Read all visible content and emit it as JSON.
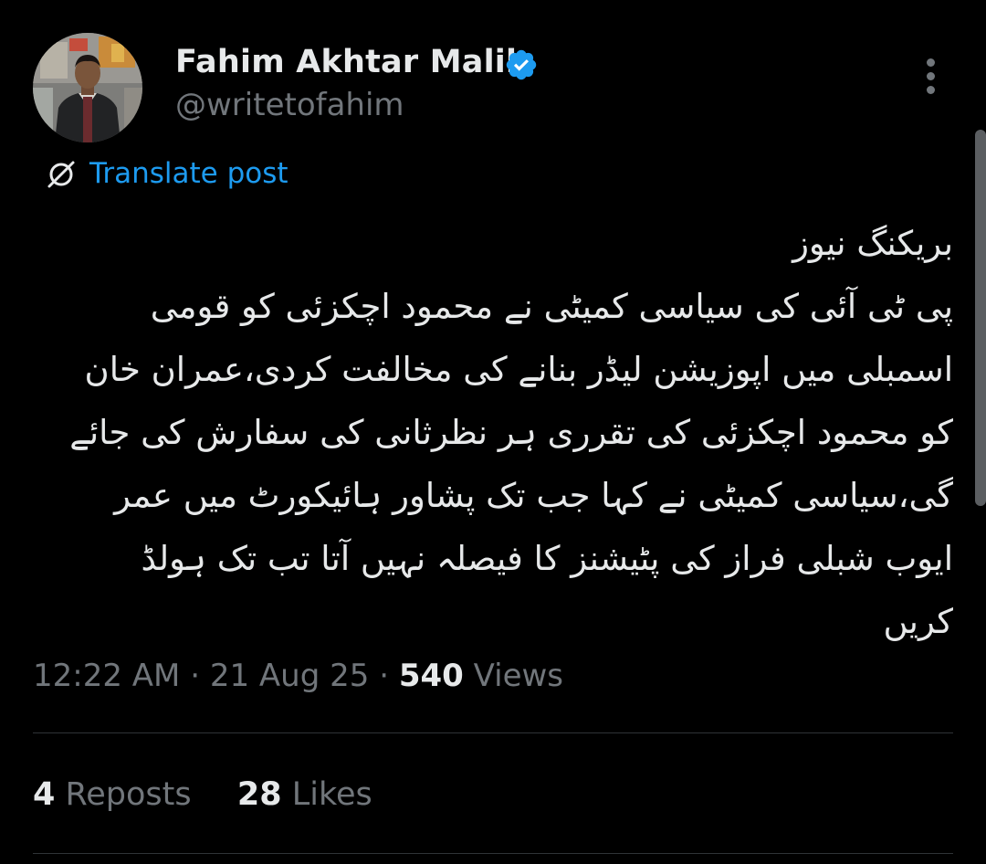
{
  "author": {
    "display_name": "Fahim Akhtar Malik",
    "handle": "@writetofahim",
    "verified_icon": "verified-badge-icon"
  },
  "translate": {
    "icon": "translate-icon",
    "label": "Translate post"
  },
  "tweet": {
    "lines": [
      "بریکنگ نیوز",
      "پی ٹی آئی کی سیاسی کمیٹی نے محمود اچکزئی کو قومی",
      "اسمبلی میں اپوزیشن لیڈر بنانے کی مخالفت کردی،عمران خان",
      "کو محمود اچکزئی کی تقرری ہر نظرثانی کی سفارش کی جائے",
      "گی،سیاسی کمیٹی نے کہا جب تک پشاور ہائیکورٹ میں عمر",
      "ایوب شبلی فراز کی پٹیشنز کا فیصلہ نہیں آتا تب تک ہولڈ",
      "کریں"
    ]
  },
  "meta": {
    "time": "12:22 AM",
    "separator": "·",
    "date": "21 Aug 25",
    "views_count": "540",
    "views_label": "Views"
  },
  "stats": {
    "reposts_count": "4",
    "reposts_label": "Reposts",
    "likes_count": "28",
    "likes_label": "Likes"
  },
  "colors": {
    "background": "#000000",
    "text_primary": "#e7e9ea",
    "text_secondary": "#71767b",
    "accent": "#1d9bf0",
    "divider": "#2f3336"
  }
}
